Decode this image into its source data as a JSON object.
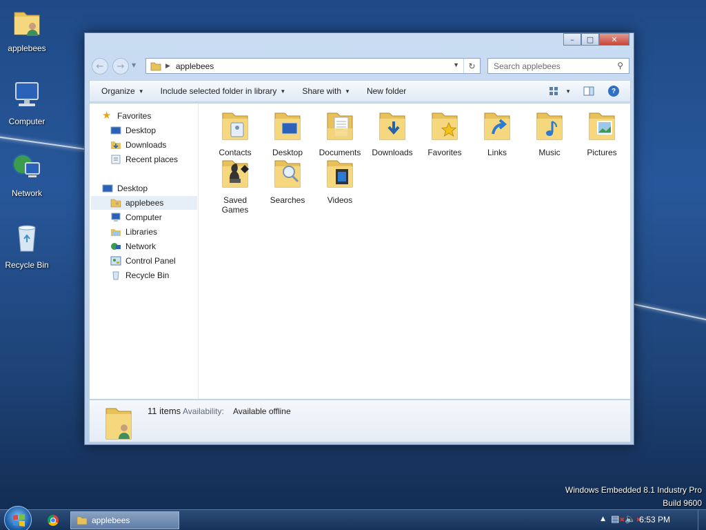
{
  "desktop": {
    "icons": [
      {
        "label": "applebees"
      },
      {
        "label": "Computer"
      },
      {
        "label": "Network"
      },
      {
        "label": "Recycle Bin"
      }
    ],
    "watermark_line1": "Windows Embedded 8.1 Industry Pro",
    "watermark_line2": "Build 9600"
  },
  "window": {
    "address_path": "applebees",
    "search_placeholder": "Search applebees",
    "toolbar": {
      "organize": "Organize",
      "include": "Include selected folder in library",
      "share": "Share with",
      "new_folder": "New folder"
    },
    "nav": {
      "favorites": "Favorites",
      "fav_desktop": "Desktop",
      "fav_downloads": "Downloads",
      "fav_recent": "Recent places",
      "desktop": "Desktop",
      "applebees": "applebees",
      "computer": "Computer",
      "libraries": "Libraries",
      "network": "Network",
      "control_panel": "Control Panel",
      "recycle_bin": "Recycle Bin"
    },
    "files": [
      {
        "label": "Contacts"
      },
      {
        "label": "Desktop"
      },
      {
        "label": "Documents"
      },
      {
        "label": "Downloads"
      },
      {
        "label": "Favorites"
      },
      {
        "label": "Links"
      },
      {
        "label": "Music"
      },
      {
        "label": "Pictures"
      },
      {
        "label": "Saved Games"
      },
      {
        "label": "Searches"
      },
      {
        "label": "Videos"
      }
    ],
    "details": {
      "count": "11 items",
      "availability_label": "Availability:",
      "availability_value": "Available offline"
    }
  },
  "taskbar": {
    "task_label": "applebees",
    "time": "6:53 PM"
  }
}
